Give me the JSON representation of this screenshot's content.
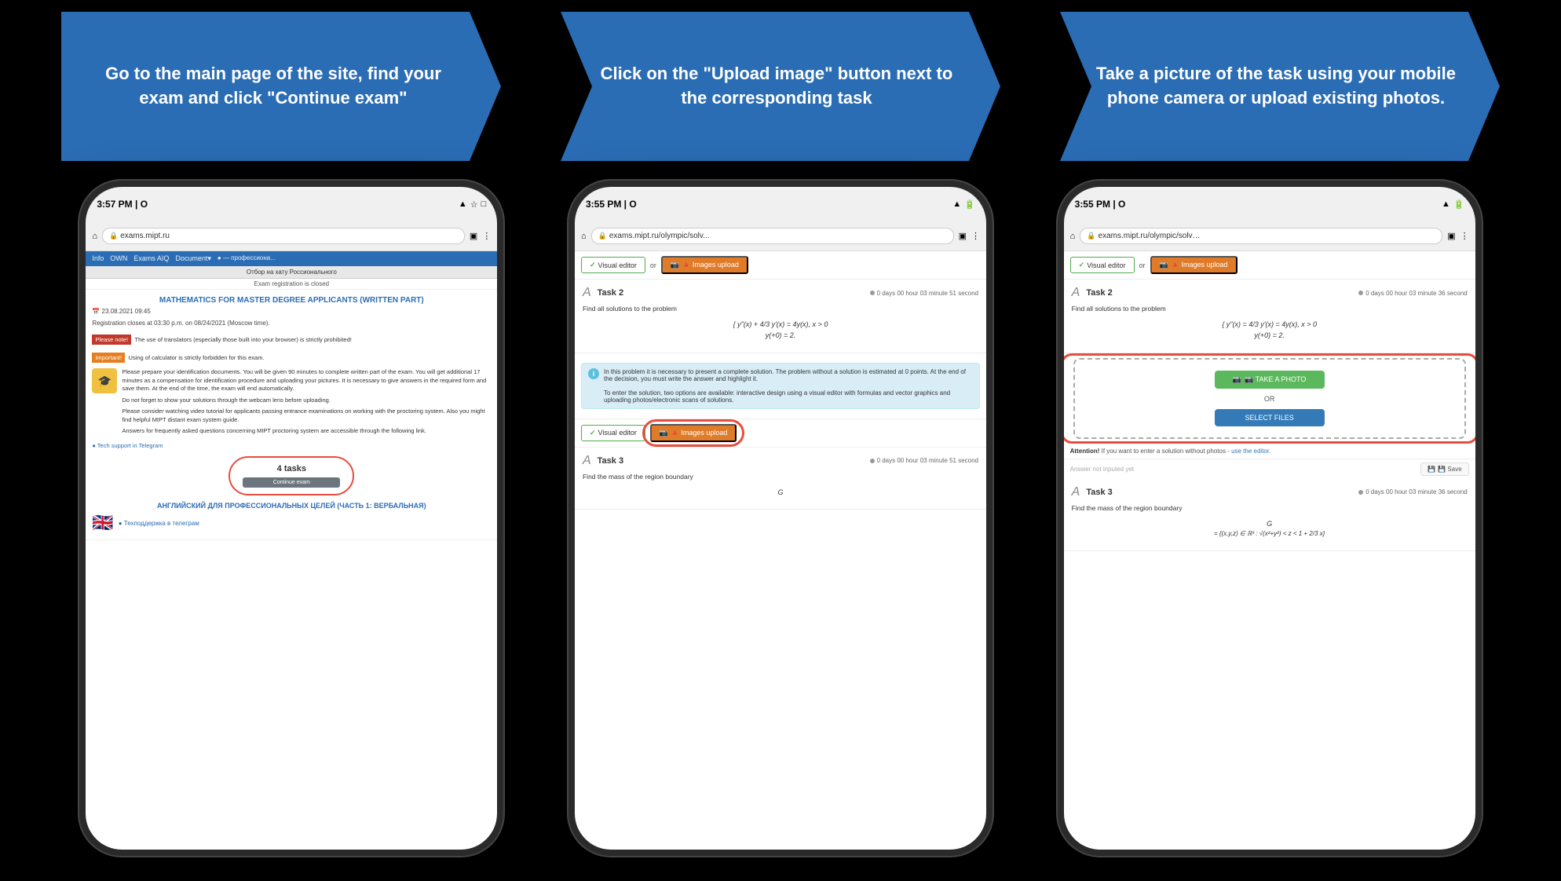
{
  "top": {
    "step1": {
      "text": "Go to the main page of the site, find your exam and click \"Continue exam\""
    },
    "step2": {
      "text": "Click on the \"Upload image\" button next to the corresponding task"
    },
    "step3": {
      "text": "Take a picture of the task using your mobile phone camera or upload existing photos."
    }
  },
  "phone1": {
    "status_time": "3:57 PM | O",
    "wifi": "▾ ☆ □",
    "url": "exams.mipt.ru",
    "nav": [
      "Info",
      "OWN",
      "Exams AIQ",
      "Document▾",
      "● — профессиона..."
    ],
    "sub_header": "Отбор на хату Россионального",
    "exam_closed": "Exam registration is closed",
    "exam_title": "MATHEMATICS FOR MASTER DEGREE APPLICANTS (WRITTEN PART)",
    "exam_date": "📅 23.08.2021 09:45",
    "reg_closes": "Registration closes at 03:30 p.m. on 08/24/2021 (Moscow time).",
    "note_label": "Please note!",
    "note_text": "The use of translators (especially those built into your browser) is strictly prohibited!",
    "important_label": "Important!",
    "important_text": "Using of calculator is strictly forbidden for this exam.",
    "body_text1": "Please prepare your identification documents. You will be given 90 minutes to complete written part of the exam. You will get additional 17 minutes as a compensation for identification procedure and uploading your pictures. It is necessary to give answers in the required form and save them. At the end of the time, the exam will end automatically.",
    "body_text2": "Do not forget to show your solutions through the webcam lens before uploading.",
    "body_text3": "Please consider watching video tutorial for applicants passing entrance examinations on working with the proctoring system. Also you might find helpful MIPT distant exam system guide.",
    "body_text4": "Answers for frequently asked questions concerning MIPT proctoring system are accessible through the following link.",
    "support_link": "● Tech support in Telegram",
    "tasks_count": "4 tasks",
    "continue_btn": "Continue exam",
    "exam_title2": "АНГЛИЙСКИЙ ДЛЯ ПРОФЕССИОНАЛЬНЫХ ЦЕЛЕЙ (ЧАСТЬ 1: ВЕРБАЛЬНАЯ)",
    "support_link2": "● Техподдержка в телеграм"
  },
  "phone2": {
    "status_time": "3:55 PM | O",
    "url": "exams.mipt.ru/olympic/solv...",
    "visual_editor_btn": "✓ Visual editor",
    "or_text": "or",
    "images_upload_btn": "🔺 Images upload",
    "task_title": "Task 2",
    "task_timer": "0 days 00 hour 03 minute 51 second",
    "problem_text": "Find all solutions to the problem",
    "math_formula1": "{ y\"(x) + 4/3 y'(x) = 4y(x), x > 0",
    "math_formula2": "  y(+0) = 2.",
    "info_text": "In this problem it is necessary to present a complete solution. The problem without a solution is estimated at 0 points. At the end of the decision, you must write the answer and highlight it.",
    "info_text2": "To enter the solution, two options are available: interactive design using a visual editor with formulas and vector graphics and uploading photos/electronic scans of solutions.",
    "visual_editor_btn2": "✓ Visual editor",
    "images_upload_btn2": "🔺 Images upload",
    "task3_title": "Task 3",
    "task3_timer": "0 days 00 hour 03 minute 51 second",
    "task3_text": "Find the mass of the region boundary",
    "task3_math": "G"
  },
  "phone3": {
    "status_time": "3:55 PM | O",
    "url": "exams.mipt.ru/olympic/solv…",
    "visual_editor_btn": "✓ Visual editor",
    "or_text": "or",
    "images_upload_btn": "🔺 Images upload",
    "task_title": "Task 2",
    "task_timer": "0 days 00 hour 03 minute 36 second",
    "problem_text": "Find all solutions to the problem",
    "math_formula1": "{ y\"(x) = 4/3 y'(x) = 4y(x), x > 0",
    "math_formula2": "  y(+0) = 2.",
    "take_photo_btn": "📷 TAKE A PHOTO",
    "or_label": "OR",
    "select_files_btn": "SELECT FILES",
    "attention_text": "Attention! If you want to enter a solution without photos - use the editor.",
    "answer_not_input": "Answer not inputed yet",
    "save_btn": "💾 Save",
    "task3_title": "Task 3",
    "task3_timer": "0 days 00 hour 03 minute 36 second",
    "task3_text": "Find the mass of the region boundary",
    "task3_math": "G"
  }
}
